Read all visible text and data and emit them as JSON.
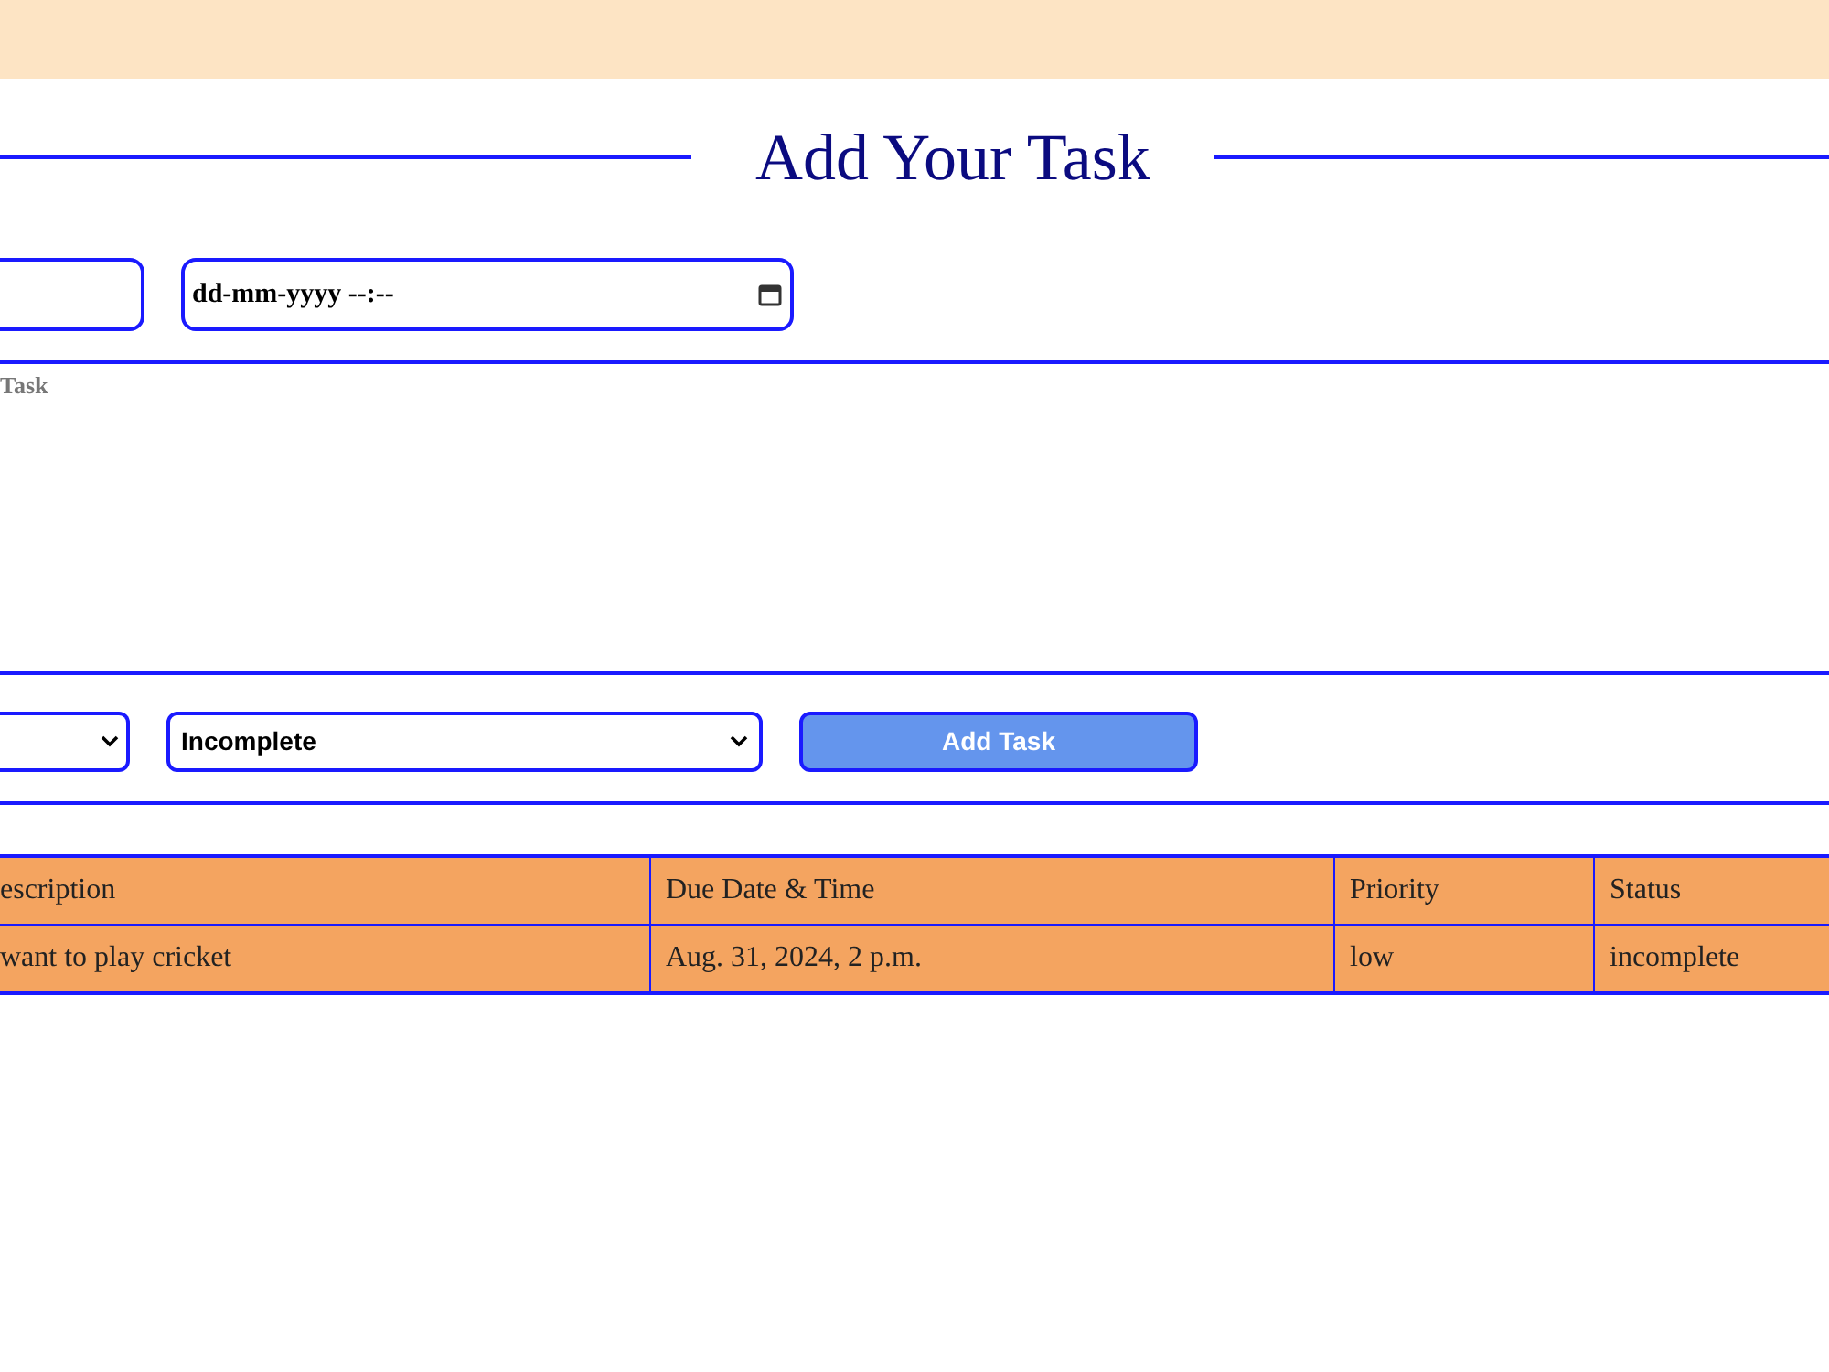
{
  "title": "Add Your Task",
  "form": {
    "due_field": {
      "placeholder": "dd-mm-yyyy --:--"
    },
    "description_field": {
      "placeholder": "Task"
    },
    "status_select": {
      "value": "Incomplete"
    },
    "submit": "Add Task"
  },
  "table": {
    "columns": [
      "escription",
      "Due Date & Time",
      "Priority",
      "Status"
    ],
    "rows": [
      [
        "want to play cricket",
        "Aug. 31, 2024, 2 p.m.",
        "low",
        "incomplete"
      ]
    ]
  }
}
